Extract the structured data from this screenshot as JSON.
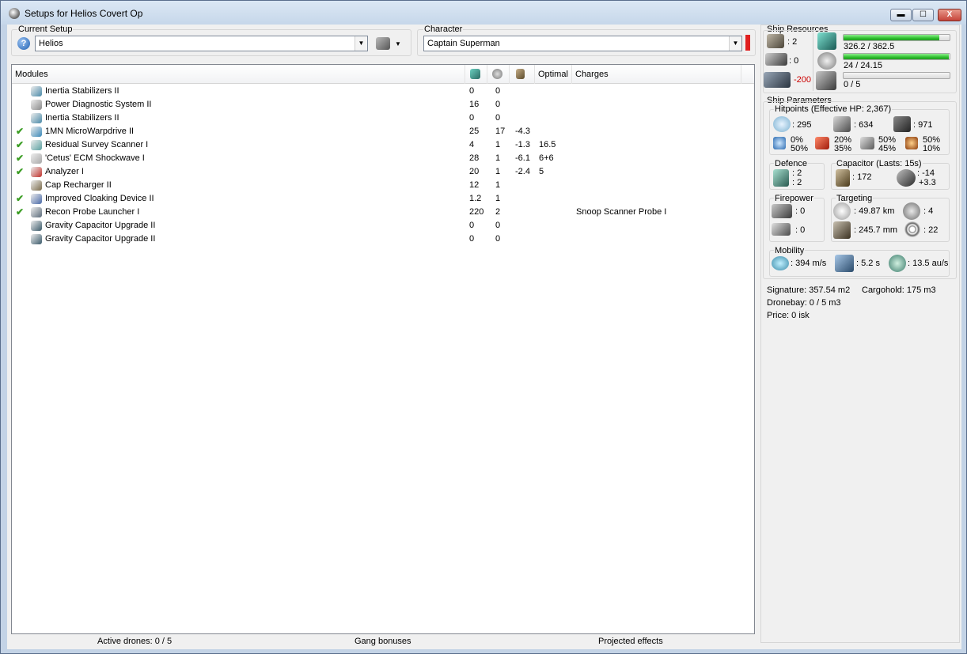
{
  "window": {
    "title": "Setups for Helios Covert Op",
    "min_label": "▬",
    "max_label": "☐",
    "close_label": "X"
  },
  "setup": {
    "label": "Current Setup",
    "value": "Helios",
    "help_label": "?"
  },
  "character": {
    "label": "Character",
    "value": "Captain Superman"
  },
  "modules": {
    "headers": {
      "name": "Modules",
      "optimal": "Optimal",
      "charges": "Charges"
    },
    "rows": [
      {
        "checked": false,
        "name": "Inertia Stabilizers II",
        "v1": "0",
        "v2": "0",
        "v3": "",
        "optimal": "",
        "charge": "",
        "icon": "inertia-icon",
        "color": "#4a8aa8"
      },
      {
        "checked": false,
        "name": "Power Diagnostic System II",
        "v1": "16",
        "v2": "0",
        "v3": "",
        "optimal": "",
        "charge": "",
        "icon": "power-diagnostic-icon",
        "color": "#8a8a8a"
      },
      {
        "checked": false,
        "name": "Inertia Stabilizers II",
        "v1": "0",
        "v2": "0",
        "v3": "",
        "optimal": "",
        "charge": "",
        "icon": "inertia-icon",
        "color": "#4a8aa8"
      },
      {
        "checked": true,
        "name": "1MN MicroWarpdrive II",
        "v1": "25",
        "v2": "17",
        "v3": "-4.3",
        "optimal": "",
        "charge": "",
        "icon": "microwarpdrive-icon",
        "color": "#3a88b8"
      },
      {
        "checked": true,
        "name": "Residual Survey Scanner I",
        "v1": "4",
        "v2": "1",
        "v3": "-1.3",
        "optimal": "16.5",
        "charge": "",
        "icon": "survey-scanner-icon",
        "color": "#5aa0a0"
      },
      {
        "checked": true,
        "name": "'Cetus' ECM Shockwave I",
        "v1": "28",
        "v2": "1",
        "v3": "-6.1",
        "optimal": "6+6",
        "charge": "",
        "icon": "ecm-icon",
        "color": "#a8a8a8"
      },
      {
        "checked": true,
        "name": "Analyzer I",
        "v1": "20",
        "v2": "1",
        "v3": "-2.4",
        "optimal": "5",
        "charge": "",
        "icon": "analyzer-icon",
        "color": "#c0302a"
      },
      {
        "checked": false,
        "name": "Cap Recharger II",
        "v1": "12",
        "v2": "1",
        "v3": "",
        "optimal": "",
        "charge": "",
        "icon": "cap-recharger-icon",
        "color": "#7a6a4a"
      },
      {
        "checked": true,
        "name": "Improved Cloaking Device II",
        "v1": "1.2",
        "v2": "1",
        "v3": "",
        "optimal": "",
        "charge": "",
        "icon": "cloak-icon",
        "color": "#4a6aa8"
      },
      {
        "checked": true,
        "name": "Recon Probe Launcher I",
        "v1": "220",
        "v2": "2",
        "v3": "",
        "optimal": "",
        "charge": "Snoop Scanner Probe I",
        "icon": "probe-launcher-icon",
        "color": "#5a6a7a"
      },
      {
        "checked": false,
        "name": "Gravity Capacitor Upgrade II",
        "v1": "0",
        "v2": "0",
        "v3": "",
        "optimal": "",
        "charge": "",
        "icon": "capacitor-upgrade-icon",
        "color": "#3a5a6a"
      },
      {
        "checked": false,
        "name": "Gravity Capacitor Upgrade II",
        "v1": "0",
        "v2": "0",
        "v3": "",
        "optimal": "",
        "charge": "",
        "icon": "capacitor-upgrade-icon",
        "color": "#3a5a6a"
      }
    ]
  },
  "status": {
    "drones": "Active drones: 0 / 5",
    "gang": "Gang bonuses",
    "projected": "Projected effects"
  },
  "resources": {
    "label": "Ship Resources",
    "turrets": ": 2",
    "launchers": ": 0",
    "calibration": "-200",
    "cpu": {
      "text": "326.2 / 362.5",
      "fraction": 0.9
    },
    "power": {
      "text": "24 / 24.15",
      "fraction": 0.99
    },
    "drone_bw": {
      "text": "0 / 5",
      "fraction": 0
    }
  },
  "params": {
    "label": "Ship Parameters",
    "hitpoints": {
      "label": "Hitpoints (Effective HP: 2,367)",
      "shield": ": 295",
      "armor": ": 634",
      "structure": ": 971",
      "resists": [
        {
          "a": "0%",
          "b": "50%"
        },
        {
          "a": "20%",
          "b": "35%"
        },
        {
          "a": "50%",
          "b": "45%"
        },
        {
          "a": "50%",
          "b": "10%"
        }
      ]
    },
    "defence": {
      "label": "Defence",
      "a": ": 2",
      "b": ": 2"
    },
    "capacitor": {
      "label": "Capacitor (Lasts: 15s)",
      "cap": ": 172",
      "a": ": -14",
      "b": "+3.3"
    },
    "firepower": {
      "label": "Firepower",
      "turret": ": 0",
      "missile": ": 0"
    },
    "targeting": {
      "label": "Targeting",
      "range": ": 49.87 km",
      "targets": ": 4",
      "resolution": ": 245.7 mm",
      "sensor": ": 22"
    },
    "mobility": {
      "label": "Mobility",
      "speed": ": 394 m/s",
      "align": ": 5.2 s",
      "warp": ": 13.5 au/s"
    }
  },
  "summary": {
    "signature": "Signature: 357.54 m2",
    "cargo": "Cargohold: 175 m3",
    "dronebay": "Dronebay: 0 / 5 m3",
    "price": "Price: 0 isk"
  }
}
